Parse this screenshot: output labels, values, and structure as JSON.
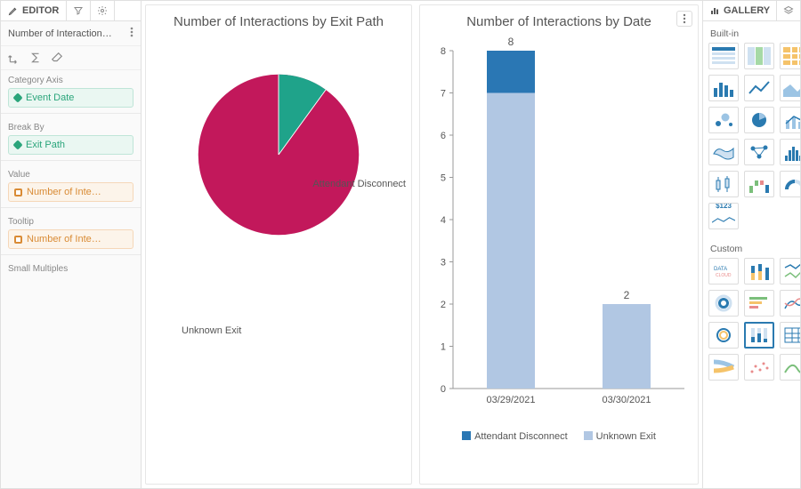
{
  "editor": {
    "tab_label": "EDITOR",
    "module_title": "Number of Interaction…",
    "sections": {
      "category_axis": {
        "label": "Category Axis",
        "chip": "Event Date"
      },
      "break_by": {
        "label": "Break By",
        "chip": "Exit Path"
      },
      "value": {
        "label": "Value",
        "chip": "Number of Inte…"
      },
      "tooltip": {
        "label": "Tooltip",
        "chip": "Number of Inte…"
      },
      "small_multiples": {
        "label": "Small Multiples"
      }
    }
  },
  "cards": {
    "pie": {
      "title": "Number of Interactions by Exit Path",
      "labels": {
        "attendant": "Attendant Disconnect",
        "unknown": "Unknown Exit"
      }
    },
    "bar": {
      "title": "Number of Interactions by Date",
      "legend": {
        "attendant": "Attendant Disconnect",
        "unknown": "Unknown Exit"
      },
      "data_labels": {
        "d0": "8",
        "d1": "2"
      },
      "x_ticks": {
        "d0": "03/29/2021",
        "d1": "03/30/2021"
      }
    }
  },
  "gallery": {
    "tab_label": "GALLERY",
    "section_builtin": "Built-in",
    "section_custom": "Custom",
    "money_label": "$123"
  },
  "colors": {
    "accent_blue": "#2a77b4",
    "light_blue": "#b1c7e3",
    "magenta": "#c2185b",
    "teal": "#1fa38a"
  },
  "chart_data": [
    {
      "type": "pie",
      "title": "Number of Interactions by Exit Path",
      "series": [
        {
          "name": "Attendant Disconnect",
          "value": 1,
          "color": "#1fa38a"
        },
        {
          "name": "Unknown Exit",
          "value": 9,
          "color": "#c2185b"
        }
      ]
    },
    {
      "type": "bar",
      "title": "Number of Interactions by Date",
      "categories": [
        "03/29/2021",
        "03/30/2021"
      ],
      "series": [
        {
          "name": "Attendant Disconnect",
          "values": [
            1,
            0
          ],
          "color": "#2a77b4"
        },
        {
          "name": "Unknown Exit",
          "values": [
            7,
            2
          ],
          "color": "#b1c7e3"
        }
      ],
      "totals": [
        8,
        2
      ],
      "ylabel": "",
      "xlabel": "",
      "ylim": [
        0,
        8
      ]
    }
  ]
}
